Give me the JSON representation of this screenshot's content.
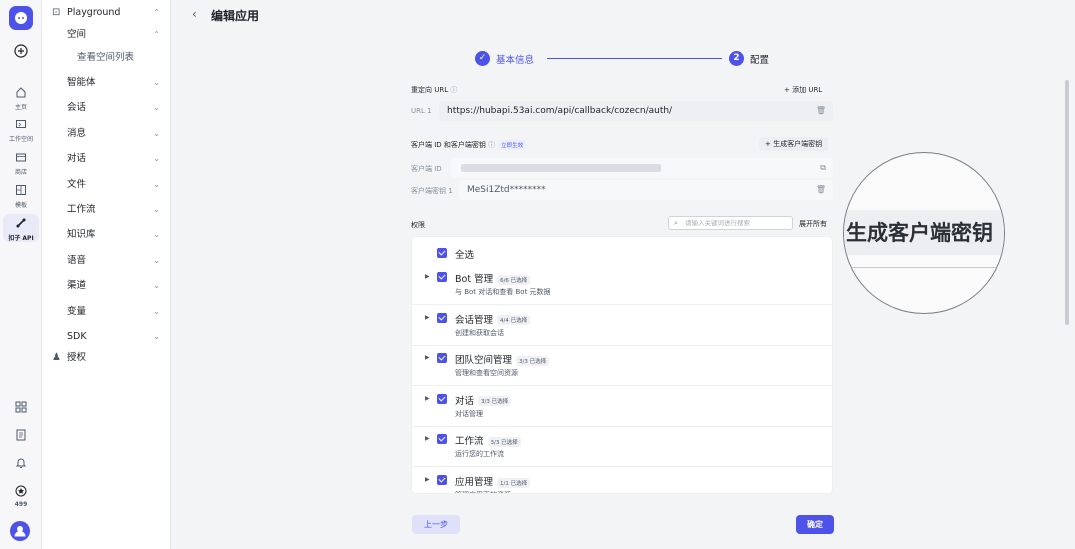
{
  "rail": {
    "items": [
      {
        "label": "主页",
        "icon": "home-icon"
      },
      {
        "label": "工作空间",
        "icon": "folder-icon"
      },
      {
        "label": "商店",
        "icon": "store-icon"
      },
      {
        "label": "模板",
        "icon": "template-icon"
      },
      {
        "label": "扣子 API",
        "icon": "api-icon"
      }
    ],
    "points": "499"
  },
  "nav": {
    "playground": "Playground",
    "space": "空间",
    "space_list": "查看空间列表",
    "items": [
      "智能体",
      "会话",
      "消息",
      "对话",
      "文件",
      "工作流",
      "知识库",
      "语音",
      "渠道",
      "变量",
      "SDK"
    ],
    "auth": "授权"
  },
  "header": {
    "title": "编辑应用"
  },
  "steps": {
    "step1": "基本信息",
    "step2_num": "2",
    "step2": "配置"
  },
  "redirect": {
    "label": "重定向 URL",
    "add": "+ 添加 URL",
    "url_label": "URL 1",
    "url_value": "https://hubapi.53ai.com/api/callback/cozecn/auth/"
  },
  "client": {
    "label": "客户端 ID 和客户端密钥",
    "badge": "立即生效",
    "gen_button": "+ 生成客户端密钥",
    "id_label": "客户端 ID",
    "secret_label": "客户端密钥 1",
    "secret_value": "MeSi1Ztd********"
  },
  "permissions": {
    "label": "权限",
    "search_placeholder": "请输入关键词进行搜索",
    "expand_all": "展开所有",
    "select_all": "全选",
    "rows": [
      {
        "title": "Bot 管理",
        "count": "6/6 已选择",
        "desc": "与 Bot 对话和查看 Bot 元数据"
      },
      {
        "title": "会话管理",
        "count": "4/4 已选择",
        "desc": "创建和获取会话"
      },
      {
        "title": "团队空间管理",
        "count": "3/3 已选择",
        "desc": "管理和查看空间资源"
      },
      {
        "title": "对话",
        "count": "3/3 已选择",
        "desc": "对话管理"
      },
      {
        "title": "工作流",
        "count": "3/3 已选择",
        "desc": "运行您的工作流"
      },
      {
        "title": "应用管理",
        "count": "1/1 已选择",
        "desc": "管理应用下的资源"
      }
    ]
  },
  "footer": {
    "prev": "上一步",
    "ok": "确定"
  },
  "magnifier": {
    "text": "生成客户端密钥"
  },
  "colors": {
    "accent": "#4d53e8",
    "background": "#f3f4f6"
  }
}
